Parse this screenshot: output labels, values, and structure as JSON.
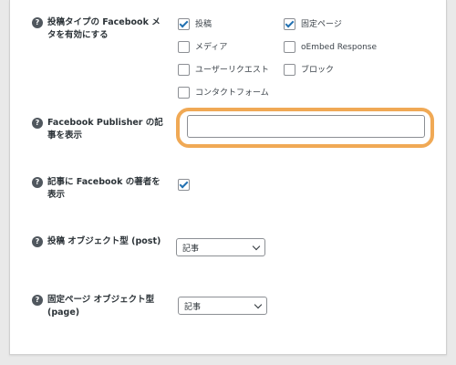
{
  "settings": {
    "row1": {
      "label": "投稿タイプの Facebook メタを有効にする",
      "options": [
        {
          "label": "投稿",
          "checked": true
        },
        {
          "label": "固定ページ",
          "checked": true
        },
        {
          "label": "メディア",
          "checked": false
        },
        {
          "label": "oEmbed Response",
          "checked": false
        },
        {
          "label": "ユーザーリクエスト",
          "checked": false
        },
        {
          "label": "ブロック",
          "checked": false
        },
        {
          "label": "コンタクトフォーム",
          "checked": false
        }
      ]
    },
    "row2": {
      "label": "Facebook Publisher の記事を表示",
      "value": ""
    },
    "row3": {
      "label": "記事に Facebook の著者を表示",
      "checked": true
    },
    "row4": {
      "label": "投稿 オブジェクト型 (post)",
      "selected": "記事"
    },
    "row5": {
      "label": "固定ページ オブジェクト型 (page)",
      "selected": "記事"
    }
  },
  "help_icon_glyph": "?",
  "colors": {
    "accent": "#2271b1",
    "highlight": "#f0a955"
  }
}
